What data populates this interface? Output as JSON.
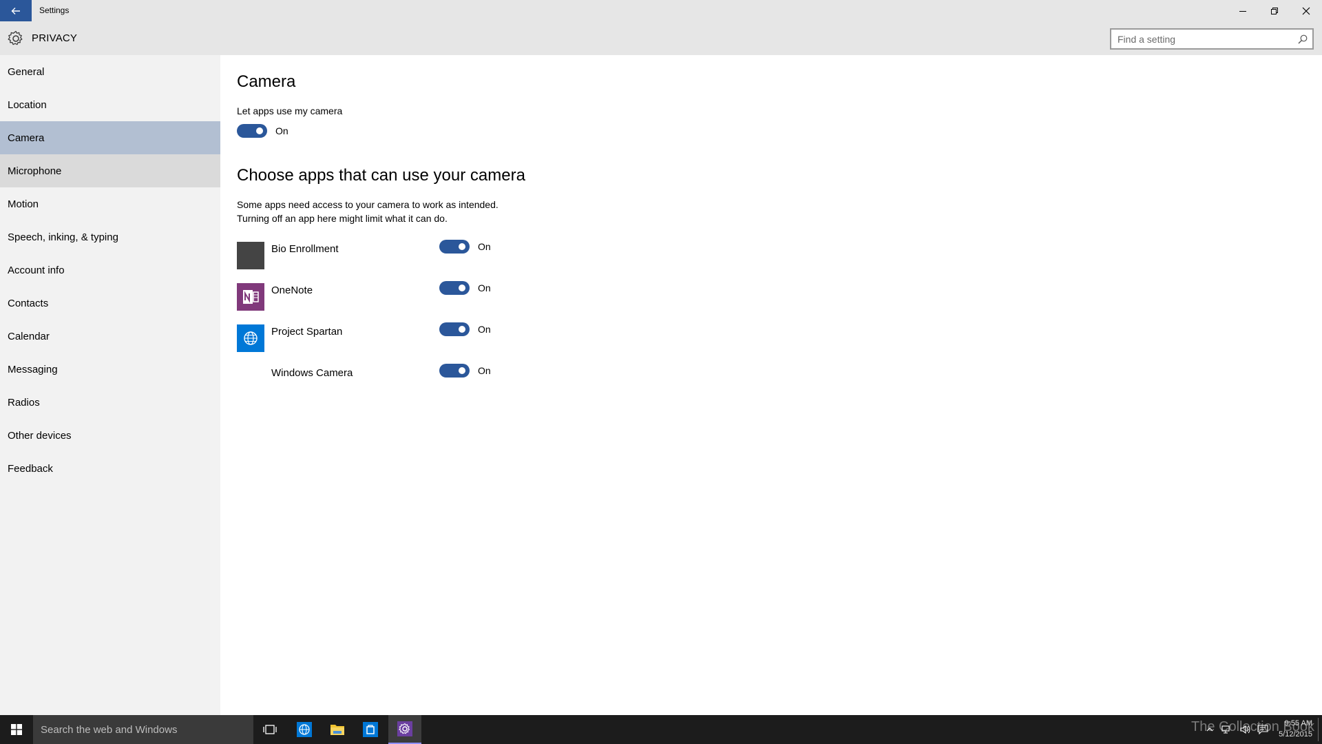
{
  "window": {
    "title": "Settings"
  },
  "header": {
    "section": "PRIVACY",
    "search_placeholder": "Find a setting"
  },
  "sidebar": {
    "items": [
      {
        "label": "General"
      },
      {
        "label": "Location"
      },
      {
        "label": "Camera"
      },
      {
        "label": "Microphone"
      },
      {
        "label": "Motion"
      },
      {
        "label": "Speech, inking, & typing"
      },
      {
        "label": "Account info"
      },
      {
        "label": "Contacts"
      },
      {
        "label": "Calendar"
      },
      {
        "label": "Messaging"
      },
      {
        "label": "Radios"
      },
      {
        "label": "Other devices"
      },
      {
        "label": "Feedback"
      }
    ],
    "selected": "Camera",
    "hovered": "Microphone"
  },
  "main": {
    "title": "Camera",
    "master_label": "Let apps use my camera",
    "master_state": "On",
    "apps_heading": "Choose apps that can use your camera",
    "description_line1": "Some apps need access to your camera to work as intended.",
    "description_line2": "Turning off an app here might limit what it can do.",
    "apps": [
      {
        "name": "Bio Enrollment",
        "state": "On",
        "icon": "bio-enrollment-icon",
        "color": "#444444"
      },
      {
        "name": "OneNote",
        "state": "On",
        "icon": "onenote-icon",
        "color": "#80397b"
      },
      {
        "name": "Project Spartan",
        "state": "On",
        "icon": "globe-icon",
        "color": "#0078d7"
      },
      {
        "name": "Windows Camera",
        "state": "On",
        "icon": "",
        "color": ""
      }
    ]
  },
  "taskbar": {
    "search_placeholder": "Search the web and Windows",
    "time": "9:55 AM",
    "date": "5/12/2015",
    "watermark": "The Collection Book"
  },
  "colors": {
    "accent": "#2b579a",
    "selected_nav": "#b2bfd2",
    "chrome": "#e6e6e6",
    "sidebar": "#f2f2f2"
  }
}
